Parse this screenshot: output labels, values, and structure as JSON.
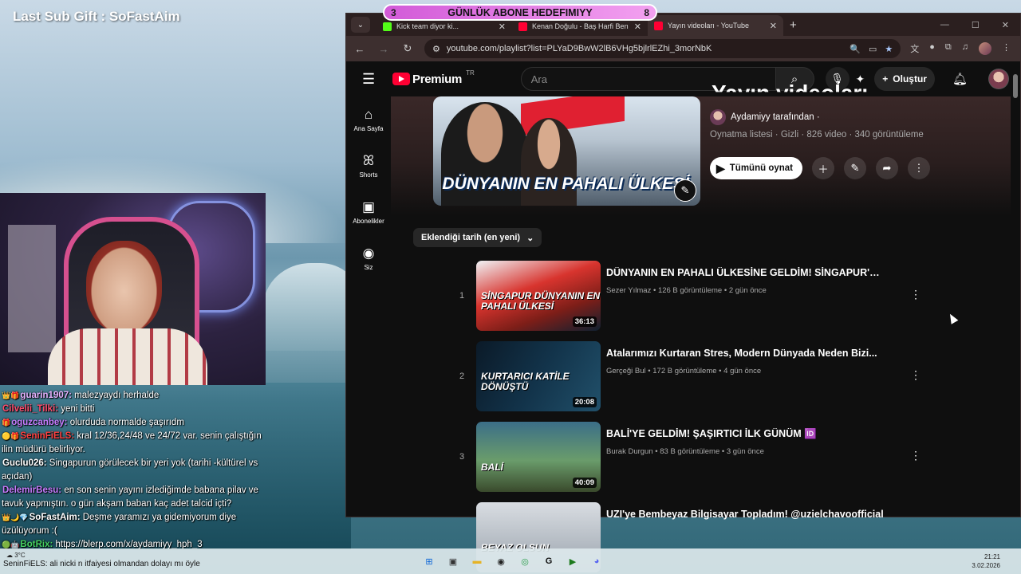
{
  "overlay": {
    "last_sub": "Last Sub Gift : SoFastAim",
    "goal": {
      "left": "3",
      "label": "GÜNLÜK ABONE HEDEFIMIYY",
      "right": "8"
    }
  },
  "chat": [
    {
      "name": "guarin1907:",
      "name_color": "#e6b3ff",
      "text": " malezyaydı herhalde",
      "badges": "👑🎁"
    },
    {
      "name": "Cilvelii_Tilki:",
      "name_color": "#ff4d6d",
      "text": " yeni bitti",
      "badges": ""
    },
    {
      "name": "oguzcanbey:",
      "name_color": "#c77dff",
      "text": " olurduda normalde şaşırıdm",
      "badges": "🎁"
    },
    {
      "name": "SeninFiELS:",
      "name_color": "#ff4040",
      "text": " kral 12/36,24/48 ve 24/72 var. senin çalıştığın ilin müdürü belirliyor.",
      "badges": "🟡🎁"
    },
    {
      "name": "Guclu026:",
      "name_color": "#ffffff",
      "text": " Singapurun görülecek bir yeri yok (tarihi -kültürel vs açıdan)",
      "badges": ""
    },
    {
      "name": "DelemirBesu:",
      "name_color": "#c77dff",
      "text": " en son senin yayını izlediğimde babana pilav ve tavuk yapmıştın. o gün akşam baban kaç adet talcid içti?",
      "badges": ""
    },
    {
      "name": "SoFastAim:",
      "name_color": "#ffffff",
      "text": " Deşme yaramızı ya gidemiyorum diye üzülüyorum :(",
      "badges": "👑🌙💎"
    },
    {
      "name": "BotRix:",
      "name_color": "#46d160",
      "text": " https://blerp.com/x/aydamiyy_hph_3",
      "badges": "🟢🤖"
    }
  ],
  "browser": {
    "tabs": [
      {
        "title": "Kick team diyor ki...",
        "fav_color": "#53fc18",
        "active": false
      },
      {
        "title": "Kenan Doğulu - Baş Harfi Ben",
        "fav_color": "#ff0033",
        "active": false
      },
      {
        "title": "Yayın videoları - YouTube",
        "fav_color": "#ff0033",
        "active": true
      }
    ],
    "url": "youtube.com/playlist?list=PLYaD9BwW2lB6VHg5bjlrlEZhi_3morNbK"
  },
  "youtube": {
    "logo_word": "Premium",
    "logo_region": "TR",
    "search_placeholder": "Ara",
    "create_label": "Oluştur",
    "sidebar": [
      {
        "icon": "⌂",
        "label": "Ana Sayfa",
        "name": "home"
      },
      {
        "icon": "ꕤ",
        "label": "Shorts",
        "name": "shorts"
      },
      {
        "icon": "▣",
        "label": "Abonelikler",
        "name": "subscriptions"
      },
      {
        "icon": "◉",
        "label": "Siz",
        "name": "you"
      }
    ],
    "playlist": {
      "title": "Yayın videoları",
      "thumb_text": "DÜNYANIN EN PAHALI ÜLKESİ",
      "owner": "Aydamiyy tarafından ·",
      "meta": "Oynatma listesi · Gizli · 826 video · 340 görüntüleme",
      "play_all": "Tümünü oynat"
    },
    "sort_label": "Eklendiği tarih (en yeni)",
    "videos": [
      {
        "idx": "1",
        "title": "DÜNYANIN EN PAHALI ÜLKESİNE GELDİM! SİNGAPUR'DA...",
        "channel": "Sezer Yılmaz",
        "views": "126 B görüntüleme",
        "age": "2 gün önce",
        "duration": "36:13",
        "cap": "SİNGAPUR DÜNYANIN EN PAHALI ÜLKESİ"
      },
      {
        "idx": "2",
        "title": "Atalarımızı Kurtaran Stres, Modern Dünyada Neden Bizi...",
        "channel": "Gerçeği Bul",
        "views": "172 B görüntüleme",
        "age": "4 gün önce",
        "duration": "20:08",
        "cap": "KURTARICI KATİLE DÖNÜŞTÜ"
      },
      {
        "idx": "3",
        "title": "BALİ'YE GELDİM! ŞAŞIRTICI İLK GÜNÜM 🆔",
        "channel": "Burak Durgun",
        "views": "83 B görüntüleme",
        "age": "3 gün önce",
        "duration": "40:09",
        "cap": "BALİ"
      },
      {
        "idx": "",
        "title": "UZI'ye Bembeyaz Bilgisayar Topladım! @uzielchavoofficial",
        "channel": "",
        "views": "",
        "age": "",
        "duration": "",
        "cap": "BEYAZ OLSUN"
      }
    ]
  },
  "taskbar": {
    "weather": "3°C",
    "time": "21:21",
    "date": "3.02.2026",
    "chat_tail": "SeninFiELS: ali nicki n itfaiyesi olmandan dolayı mı öyle"
  }
}
